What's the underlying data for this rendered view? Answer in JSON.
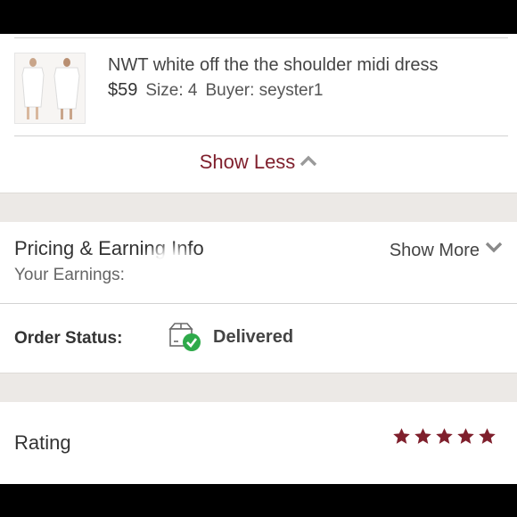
{
  "item": {
    "title": "NWT white off the the shoulder midi dress",
    "price": "$59",
    "size": "Size: 4",
    "buyer": "Buyer: seyster1",
    "thumbnail_icon": "dress-thumbnail-image"
  },
  "toggle": {
    "show_less_label": "Show Less",
    "chevron": "chevron-up-icon"
  },
  "pricing": {
    "title": "Pricing & Earning Info",
    "earnings_label": "Your Earnings:",
    "show_more_label": "Show More",
    "chevron": "chevron-down-icon"
  },
  "order_status": {
    "label": "Order Status:",
    "value": "Delivered",
    "icon": "package-delivered-icon",
    "icon_accent": "#2eaa4a"
  },
  "rating": {
    "label": "Rating",
    "stars": 5,
    "max_stars": 5,
    "star_color": "#7f1f2c"
  },
  "colors": {
    "brand": "#7f1f2c",
    "band": "#ece9e6",
    "text": "#333333"
  }
}
